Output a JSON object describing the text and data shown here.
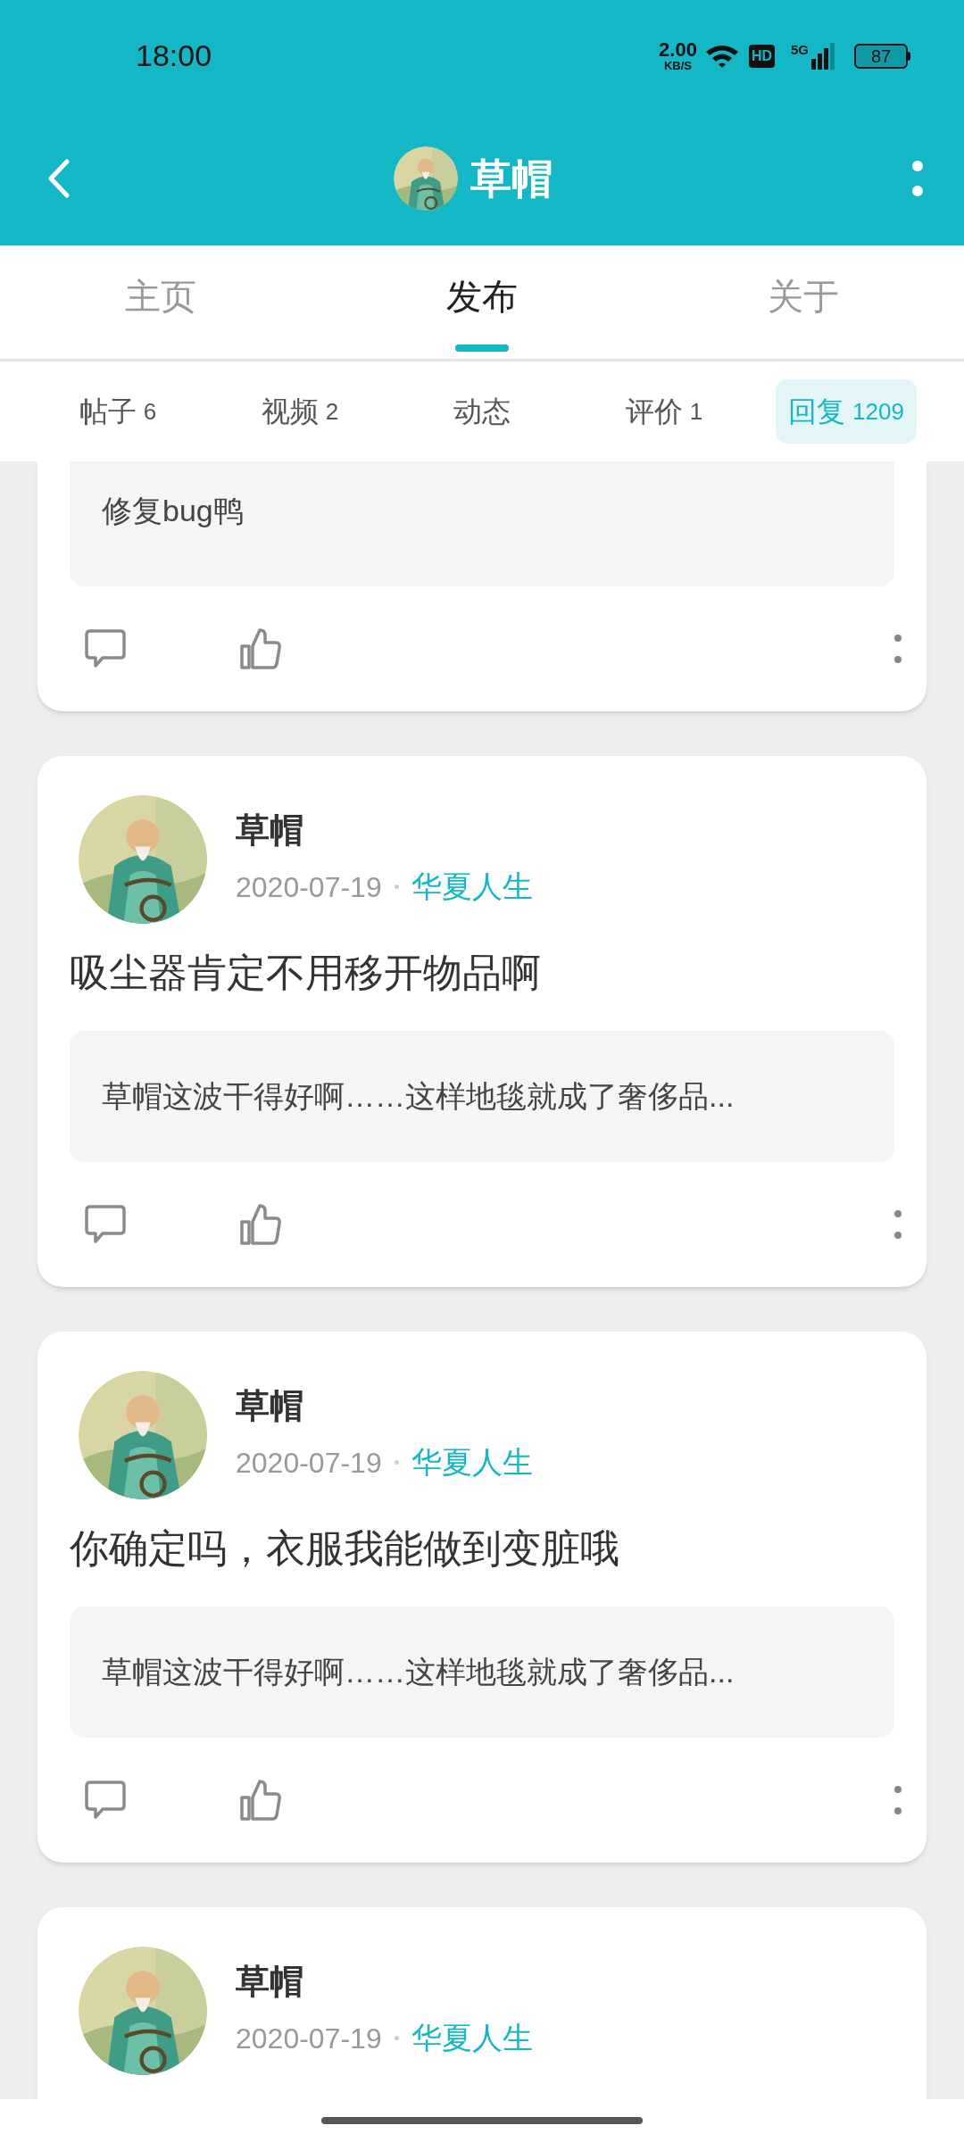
{
  "status_bar": {
    "time": "18:00",
    "net_speed": "2.00",
    "net_unit": "KB/S",
    "hd": "HD",
    "network": "5G",
    "battery": "87"
  },
  "header": {
    "title": "草帽"
  },
  "tabs": [
    {
      "label": "主页",
      "selected": false
    },
    {
      "label": "发布",
      "selected": true
    },
    {
      "label": "关于",
      "selected": false
    }
  ],
  "subtabs": [
    {
      "label": "帖子",
      "count": "6",
      "selected": false
    },
    {
      "label": "视频",
      "count": "2",
      "selected": false
    },
    {
      "label": "动态",
      "selected": false
    },
    {
      "label": "评价",
      "count": "1",
      "selected": false
    },
    {
      "label": "回复",
      "count": "1209",
      "selected": true
    }
  ],
  "posts": [
    {
      "kind": "tail",
      "quote": "修复bug鸭"
    },
    {
      "kind": "full",
      "author": "草帽",
      "date": "2020-07-19",
      "topic": "华夏人生",
      "text": "吸尘器肯定不用移开物品啊",
      "quote": "草帽这波干得好啊……这样地毯就成了奢侈品..."
    },
    {
      "kind": "full",
      "author": "草帽",
      "date": "2020-07-19",
      "topic": "华夏人生",
      "text": "你确定吗，衣服我能做到变脏哦",
      "quote": "草帽这波干得好啊……这样地毯就成了奢侈品..."
    },
    {
      "kind": "head",
      "author": "草帽",
      "date": "2020-07-19",
      "topic": "华夏人生"
    }
  ]
}
